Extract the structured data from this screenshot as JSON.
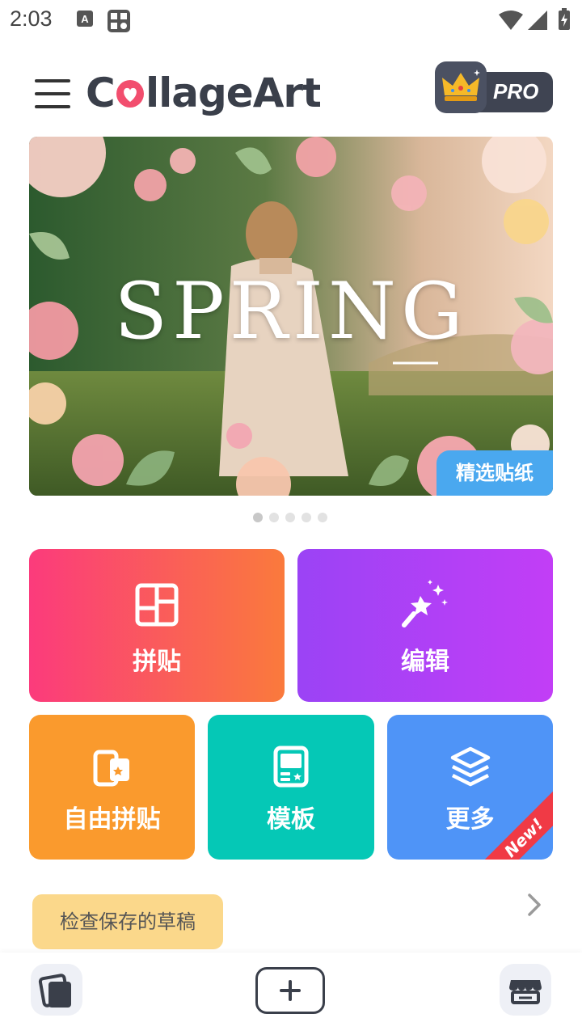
{
  "status_bar": {
    "time": "2:03",
    "icons": [
      "keyboard-a-icon",
      "sim-toolkit-icon",
      "wifi-icon",
      "cell-signal-icon",
      "battery-charging-icon"
    ]
  },
  "header": {
    "menu_icon": "hamburger-menu-icon",
    "logo": "CollageArt",
    "pro_label": "PRO",
    "pro_icon": "crown-icon"
  },
  "banner": {
    "title": "SPRING",
    "tag": "精选贴纸",
    "page_count": 5,
    "active_page": 1
  },
  "tiles": {
    "collage": {
      "label": "拼贴",
      "icon": "grid-layout-icon"
    },
    "edit": {
      "label": "编辑",
      "icon": "magic-wand-icon"
    },
    "free_collage": {
      "label": "自由拼贴",
      "icon": "freestyle-icon"
    },
    "templates": {
      "label": "模板",
      "icon": "template-icon"
    },
    "more": {
      "label": "更多",
      "icon": "layers-icon",
      "badge": "New!"
    }
  },
  "drafts": {
    "tooltip": "检查保存的草稿"
  },
  "bottom_bar": {
    "items": [
      "drafts-icon",
      "add-icon",
      "store-icon"
    ]
  },
  "colors": {
    "collage_gradient": [
      "#fb3b7c",
      "#fa7a3c"
    ],
    "edit_gradient": [
      "#9b43f5",
      "#c23ef6"
    ],
    "free_collage": "#fa9a2d",
    "templates": "#05c8b6",
    "more": "#4f94f7",
    "banner_tag": "#4aa8ef",
    "tooltip": "#fbd88b",
    "logo_heart": "#f24e6e"
  }
}
